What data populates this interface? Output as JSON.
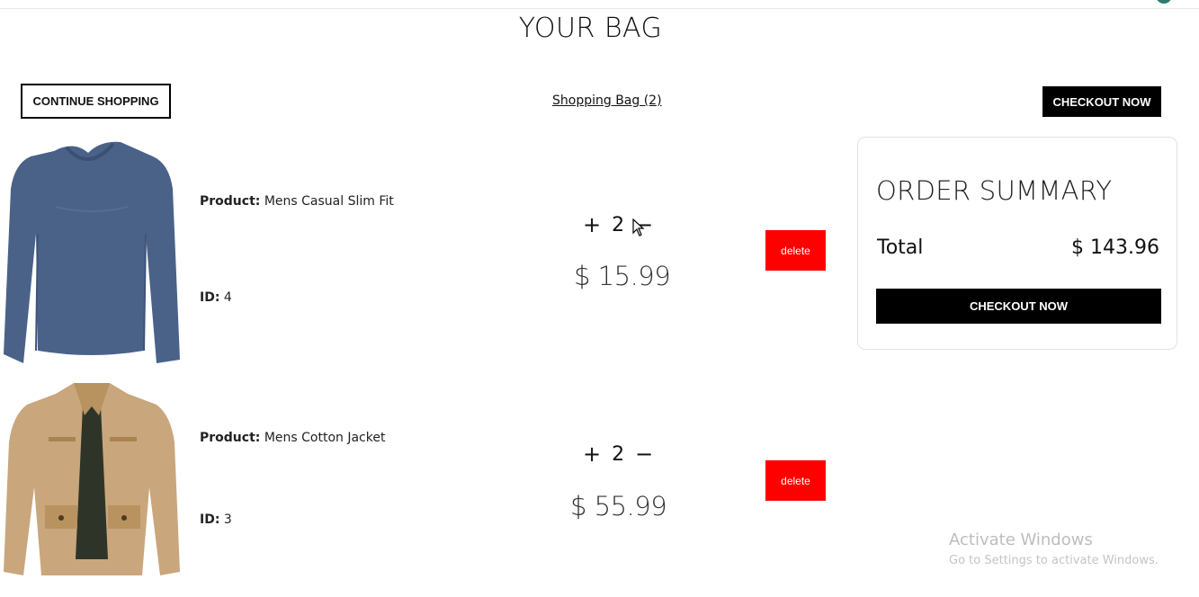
{
  "page": {
    "title": "YOUR BAG"
  },
  "top": {
    "continue_label": "CONTINUE SHOPPING",
    "bag_link": "Shopping Bag (2)",
    "checkout_label": "CHECKOUT NOW"
  },
  "items": [
    {
      "product_label": "Product:",
      "product_name": "Mens Casual Slim Fit",
      "id_label": "ID:",
      "id_value": "4",
      "plus": "+",
      "quantity": "2",
      "minus": "−",
      "price": "$ 15.99",
      "delete_label": "delete",
      "image_icon": "blue-longsleeve-shirt",
      "image_color": "#4a6288"
    },
    {
      "product_label": "Product:",
      "product_name": "Mens Cotton Jacket",
      "id_label": "ID:",
      "id_value": "3",
      "plus": "+",
      "quantity": "2",
      "minus": "−",
      "price": "$ 55.99",
      "delete_label": "delete",
      "image_icon": "tan-jacket",
      "image_color": "#c9a67c"
    }
  ],
  "summary": {
    "title": "ORDER SUMMARY",
    "total_label": "Total",
    "total_value": "$ 143.96",
    "checkout_label": "CHECKOUT NOW"
  },
  "watermark": {
    "title": "Activate Windows",
    "subtitle": "Go to Settings to activate Windows."
  },
  "colors": {
    "accent_black": "#000000",
    "delete_red": "#ff0000",
    "watermark_gray": "#bdbdbd"
  }
}
